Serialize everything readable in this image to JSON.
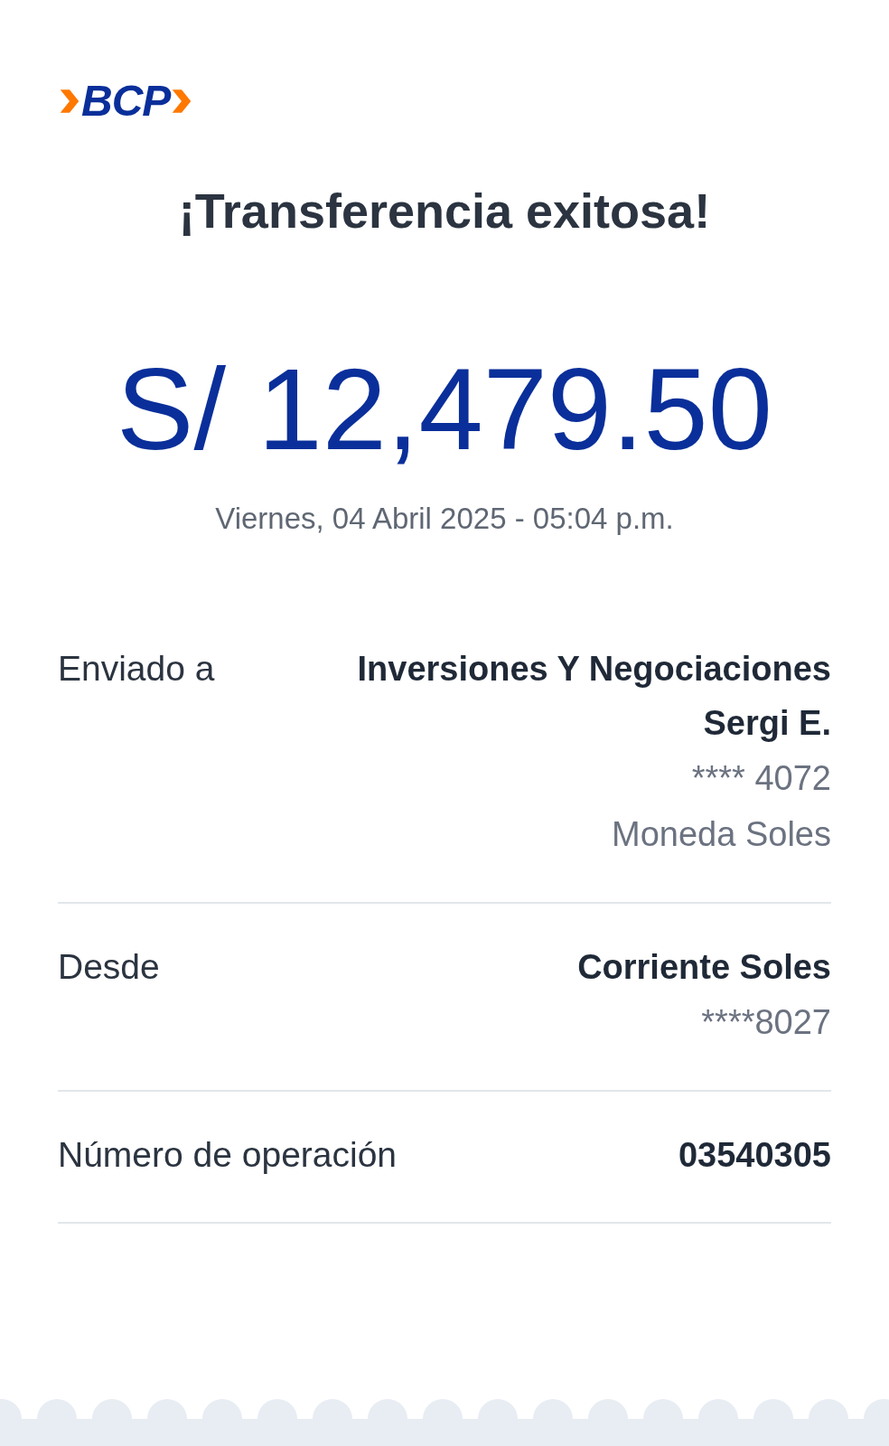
{
  "logo": {
    "text": "BCP"
  },
  "title": "¡Transferencia exitosa!",
  "amount": "S/ 12,479.50",
  "datetime": "Viernes, 04 Abril 2025 - 05:04 p.m.",
  "details": [
    {
      "label": "Enviado a",
      "value": "Inversiones Y Negociaciones Sergi E.",
      "sub": [
        "**** 4072",
        "Moneda Soles"
      ]
    },
    {
      "label": "Desde",
      "value": "Corriente Soles",
      "sub": [
        "****8027"
      ]
    },
    {
      "label": "Número de operación",
      "value": "03540305"
    }
  ]
}
